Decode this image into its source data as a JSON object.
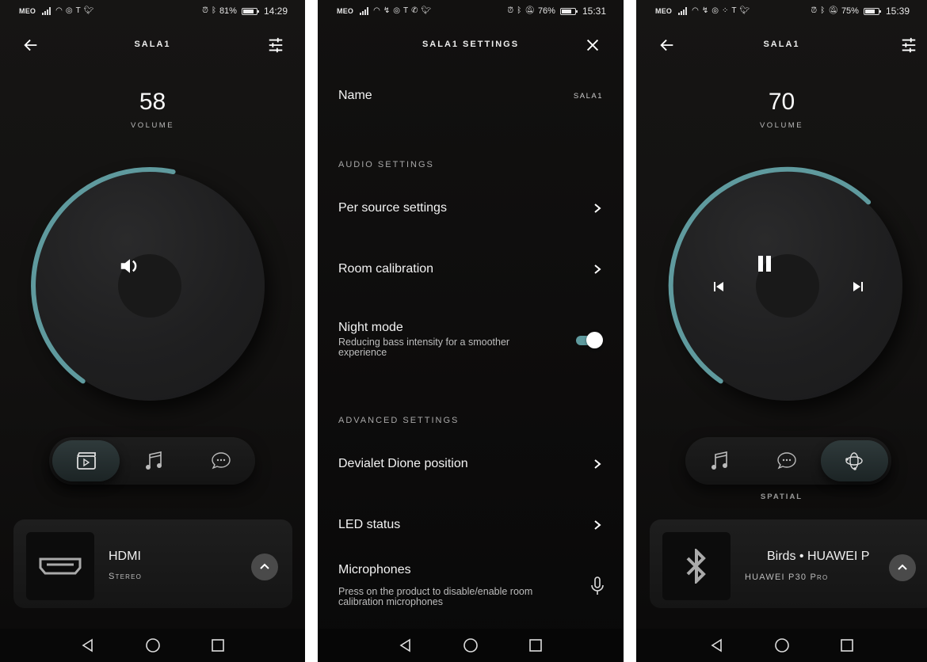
{
  "colors": {
    "accent": "#5f9a9e",
    "background": "#131211",
    "card": "#1b1b1b",
    "text": "#f2f2f2"
  },
  "screens": [
    {
      "status": {
        "carrier": "MEO",
        "icons": [
          "signal-icon",
          "wifi-icon",
          "data-saver-icon",
          "tesla-icon",
          "twitter-icon"
        ],
        "right_icons": [
          "alarm-icon",
          "bluetooth-icon"
        ],
        "battery": "81%",
        "battery_level": 0.81,
        "time": "14:29"
      },
      "header": {
        "title": "SALA1",
        "back_icon": "arrow-left-icon",
        "settings_icon": "sliders-icon"
      },
      "volume": {
        "value": "58",
        "label": "VOLUME",
        "level": 0.58
      },
      "dial": {
        "center_icon": "speaker-icon"
      },
      "modes": [
        {
          "name": "movie",
          "icon": "clapperboard-icon",
          "active": true
        },
        {
          "name": "music",
          "icon": "music-note-icon",
          "active": false
        },
        {
          "name": "voice",
          "icon": "chat-bubble-icon",
          "active": false
        }
      ],
      "now_playing": {
        "title": "HDMI",
        "subtitle": "Stereo",
        "art_icon": "hdmi-icon"
      }
    },
    {
      "status": {
        "carrier": "MEO",
        "icons": [
          "signal-icon",
          "wifi-icon",
          "missed-call-icon",
          "data-saver-icon",
          "tesla-icon",
          "whatsapp-icon",
          "twitter-icon"
        ],
        "right_icons": [
          "alarm-icon",
          "bluetooth-icon",
          "bell-off-icon"
        ],
        "battery": "76%",
        "battery_level": 0.76,
        "time": "15:31"
      },
      "header": {
        "title": "SALA1 SETTINGS"
      },
      "name_row": {
        "label": "Name",
        "value": "SALA1"
      },
      "sections": {
        "audio": "AUDIO SETTINGS",
        "advanced": "ADVANCED SETTINGS"
      },
      "audio_items": [
        {
          "label": "Per source settings"
        },
        {
          "label": "Room calibration"
        }
      ],
      "night_mode": {
        "label": "Night mode",
        "description": "Reducing bass intensity for a smoother experience",
        "enabled": true
      },
      "advanced_items": [
        {
          "label": "Devialet Dione position"
        },
        {
          "label": "LED status"
        }
      ],
      "microphones": {
        "label": "Microphones",
        "description": "Press on the product to disable/enable room calibration microphones"
      }
    },
    {
      "status": {
        "carrier": "MEO",
        "icons": [
          "signal-icon",
          "wifi-icon",
          "missed-call-icon",
          "data-saver-icon",
          "dots-icon",
          "tesla-icon",
          "twitter-icon"
        ],
        "right_icons": [
          "alarm-icon",
          "bluetooth-icon",
          "bell-off-icon"
        ],
        "battery": "75%",
        "battery_level": 0.75,
        "time": "15:39"
      },
      "header": {
        "title": "SALA1",
        "back_icon": "arrow-left-icon",
        "settings_icon": "sliders-icon"
      },
      "volume": {
        "value": "70",
        "label": "VOLUME",
        "level": 0.7
      },
      "dial": {
        "prev_icon": "skip-previous-icon",
        "center_icon": "pause-icon",
        "next_icon": "skip-next-icon"
      },
      "modes": [
        {
          "name": "music",
          "icon": "music-note-icon",
          "active": false
        },
        {
          "name": "voice",
          "icon": "chat-bubble-icon",
          "active": false
        },
        {
          "name": "spatial",
          "icon": "spatial-orbit-icon",
          "active": true
        }
      ],
      "mode_label": "SPATIAL",
      "now_playing": {
        "title": "Birds • HUAWEI P",
        "subtitle": "HUAWEI P30 Pro",
        "art_icon": "bluetooth-icon"
      }
    }
  ]
}
